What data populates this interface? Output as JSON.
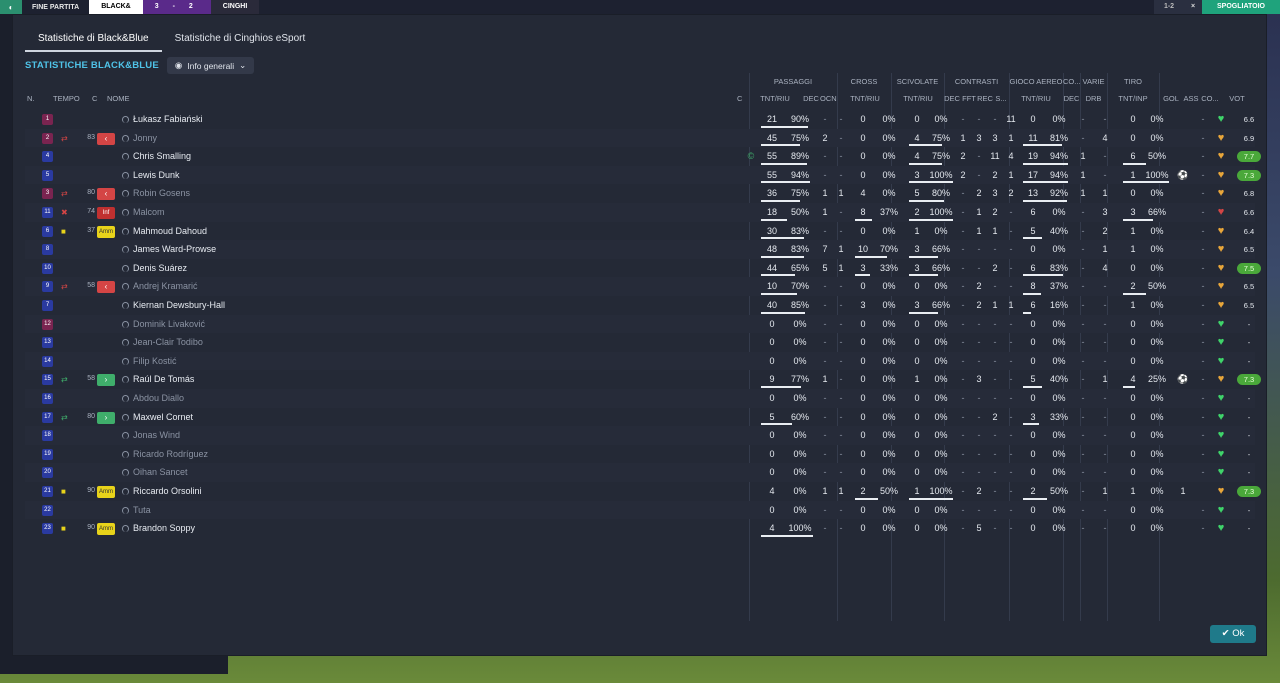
{
  "topbar": {
    "end_label": "FINE PARTITA",
    "team1": "BLACK&",
    "score": "3 - 2",
    "team2": "CINGHI",
    "s_label": "1-2",
    "close": "×",
    "skip": "SPOGLIATOIO"
  },
  "tabs": [
    "Statistiche di Black&Blue",
    "Statistiche di Cinghios eSport"
  ],
  "section_title": "STATISTICHE BLACK&BLUE",
  "dropdown": "Info generali",
  "groups": [
    "PASSAGGI",
    "CROSS",
    "SCIVOLATE",
    "CONTRASTI",
    "GIOCO AEREO",
    "CO...",
    "VARIE",
    "TIRO"
  ],
  "headers": {
    "n": "N.",
    "tempo": "TEMPO",
    "c": "C",
    "nome": "NOME",
    "c2": "C",
    "pass": "TNT/RIU",
    "dec": "DEC",
    "ocn": "OCN",
    "cross": "TNT/RIU",
    "sciv": "TNT/RIU",
    "cdec": "DEC",
    "cfft": "FFT",
    "crec": "REC",
    "cs": "S...",
    "aereo": "TNT/RIU",
    "codec": "DEC",
    "drb": "DRB",
    "tiro": "TNT/INP",
    "gol": "GOL",
    "ass": "ASS",
    "co": "CO...",
    "voto": "VOT"
  },
  "ok": "Ok",
  "players": [
    {
      "n": "1",
      "gk": true,
      "ev": "",
      "min": "",
      "sub": "",
      "name": "Łukasz Fabiański",
      "dim": false,
      "pt": "21",
      "pp": "90%",
      "dec": "-",
      "ocn": "-",
      "ct": "0",
      "cp": "0%",
      "st": "0",
      "sp": "0%",
      "cd": "-",
      "cf": "-",
      "cr": "-",
      "cs": "11",
      "at": "0",
      "ap": "0%",
      "cod": "-",
      "drb": "-",
      "tt": "0",
      "tp": "0%",
      "gol": "",
      "ass": "-",
      "vote": "6.6",
      "vg": false
    },
    {
      "n": "2",
      "gk": true,
      "ev": "⇄",
      "min": "83",
      "sub": "out",
      "name": "Jonny",
      "dim": true,
      "pt": "45",
      "pp": "75%",
      "dec": "2",
      "ocn": "-",
      "ct": "0",
      "cp": "0%",
      "st": "4",
      "sp": "75%",
      "cd": "1",
      "cf": "3",
      "cr": "3",
      "cs": "1",
      "at": "11",
      "ap": "81%",
      "cod": "-",
      "drb": "4",
      "tt": "0",
      "tp": "0%",
      "gol": "",
      "ass": "-",
      "vote": "6.9",
      "vg": false
    },
    {
      "n": "4",
      "gk": false,
      "ev": "",
      "min": "",
      "sub": "",
      "name": "Chris Smalling",
      "dim": false,
      "pt": "55",
      "pp": "89%",
      "dec": "-",
      "ocn": "-",
      "ct": "0",
      "cp": "0%",
      "st": "4",
      "sp": "75%",
      "cd": "2",
      "cf": "-",
      "cr": "11",
      "cs": "4",
      "at": "19",
      "ap": "94%",
      "cod": "1",
      "drb": "-",
      "tt": "6",
      "tp": "50%",
      "gol": "",
      "ass": "-",
      "vote": "7.7",
      "vg": true
    },
    {
      "n": "5",
      "gk": false,
      "ev": "",
      "min": "",
      "sub": "",
      "name": "Lewis Dunk",
      "dim": false,
      "pt": "55",
      "pp": "94%",
      "dec": "-",
      "ocn": "-",
      "ct": "0",
      "cp": "0%",
      "st": "3",
      "sp": "100%",
      "cd": "2",
      "cf": "-",
      "cr": "2",
      "cs": "1",
      "at": "17",
      "ap": "94%",
      "cod": "1",
      "drb": "-",
      "tt": "1",
      "tp": "100%",
      "gol": "⚽",
      "ass": "-",
      "vote": "7.3",
      "vg": true
    },
    {
      "n": "3",
      "gk": true,
      "ev": "⇄",
      "min": "80",
      "sub": "out",
      "name": "Robin Gosens",
      "dim": true,
      "pt": "36",
      "pp": "75%",
      "dec": "1",
      "ocn": "1",
      "ct": "4",
      "cp": "0%",
      "st": "5",
      "sp": "80%",
      "cd": "-",
      "cf": "2",
      "cr": "3",
      "cs": "2",
      "at": "13",
      "ap": "92%",
      "cod": "1",
      "drb": "1",
      "tt": "0",
      "tp": "0%",
      "gol": "",
      "ass": "-",
      "vote": "6.8",
      "vg": false
    },
    {
      "n": "11",
      "gk": false,
      "ev": "✖",
      "min": "74",
      "sub": "inf",
      "name": "Malcom",
      "dim": true,
      "pt": "18",
      "pp": "50%",
      "dec": "1",
      "ocn": "-",
      "ct": "8",
      "cp": "37%",
      "st": "2",
      "sp": "100%",
      "cd": "-",
      "cf": "1",
      "cr": "2",
      "cs": "-",
      "at": "6",
      "ap": "0%",
      "cod": "-",
      "drb": "3",
      "tt": "3",
      "tp": "66%",
      "gol": "",
      "ass": "-",
      "vote": "6.6",
      "vg": false
    },
    {
      "n": "6",
      "gk": false,
      "ev": "■",
      "min": "37",
      "sub": "amm",
      "name": "Mahmoud Dahoud",
      "dim": false,
      "pt": "30",
      "pp": "83%",
      "dec": "-",
      "ocn": "-",
      "ct": "0",
      "cp": "0%",
      "st": "1",
      "sp": "0%",
      "cd": "-",
      "cf": "1",
      "cr": "1",
      "cs": "-",
      "at": "5",
      "ap": "40%",
      "cod": "-",
      "drb": "2",
      "tt": "1",
      "tp": "0%",
      "gol": "",
      "ass": "-",
      "vote": "6.4",
      "vg": false
    },
    {
      "n": "8",
      "gk": false,
      "ev": "",
      "min": "",
      "sub": "",
      "name": "James Ward-Prowse",
      "dim": false,
      "pt": "48",
      "pp": "83%",
      "dec": "7",
      "ocn": "1",
      "ct": "10",
      "cp": "70%",
      "st": "3",
      "sp": "66%",
      "cd": "-",
      "cf": "-",
      "cr": "-",
      "cs": "-",
      "at": "0",
      "ap": "0%",
      "cod": "-",
      "drb": "1",
      "tt": "1",
      "tp": "0%",
      "gol": "",
      "ass": "-",
      "vote": "6.5",
      "vg": false
    },
    {
      "n": "10",
      "gk": false,
      "ev": "",
      "min": "",
      "sub": "",
      "name": "Denis Suárez",
      "dim": false,
      "pt": "44",
      "pp": "65%",
      "dec": "5",
      "ocn": "1",
      "ct": "3",
      "cp": "33%",
      "st": "3",
      "sp": "66%",
      "cd": "-",
      "cf": "-",
      "cr": "2",
      "cs": "-",
      "at": "6",
      "ap": "83%",
      "cod": "-",
      "drb": "4",
      "tt": "0",
      "tp": "0%",
      "gol": "",
      "ass": "-",
      "vote": "7.5",
      "vg": true
    },
    {
      "n": "9",
      "gk": false,
      "ev": "⇄",
      "min": "58",
      "sub": "out",
      "name": "Andrej Kramarić",
      "dim": true,
      "pt": "10",
      "pp": "70%",
      "dec": "-",
      "ocn": "-",
      "ct": "0",
      "cp": "0%",
      "st": "0",
      "sp": "0%",
      "cd": "-",
      "cf": "2",
      "cr": "-",
      "cs": "-",
      "at": "8",
      "ap": "37%",
      "cod": "-",
      "drb": "-",
      "tt": "2",
      "tp": "50%",
      "gol": "",
      "ass": "-",
      "vote": "6.5",
      "vg": false
    },
    {
      "n": "7",
      "gk": false,
      "ev": "",
      "min": "",
      "sub": "",
      "name": "Kiernan Dewsbury-Hall",
      "dim": false,
      "pt": "40",
      "pp": "85%",
      "dec": "-",
      "ocn": "-",
      "ct": "3",
      "cp": "0%",
      "st": "3",
      "sp": "66%",
      "cd": "-",
      "cf": "2",
      "cr": "1",
      "cs": "1",
      "at": "6",
      "ap": "16%",
      "cod": "-",
      "drb": "-",
      "tt": "1",
      "tp": "0%",
      "gol": "",
      "ass": "-",
      "vote": "6.5",
      "vg": false
    },
    {
      "n": "12",
      "gk": true,
      "ev": "",
      "min": "",
      "sub": "",
      "name": "Dominik Livaković",
      "dim": true,
      "pt": "0",
      "pp": "0%",
      "dec": "-",
      "ocn": "-",
      "ct": "0",
      "cp": "0%",
      "st": "0",
      "sp": "0%",
      "cd": "-",
      "cf": "-",
      "cr": "-",
      "cs": "-",
      "at": "0",
      "ap": "0%",
      "cod": "-",
      "drb": "-",
      "tt": "0",
      "tp": "0%",
      "gol": "",
      "ass": "-",
      "vote": "-",
      "vg": false
    },
    {
      "n": "13",
      "gk": false,
      "ev": "",
      "min": "",
      "sub": "",
      "name": "Jean-Clair Todibo",
      "dim": true,
      "pt": "0",
      "pp": "0%",
      "dec": "-",
      "ocn": "-",
      "ct": "0",
      "cp": "0%",
      "st": "0",
      "sp": "0%",
      "cd": "-",
      "cf": "-",
      "cr": "-",
      "cs": "-",
      "at": "0",
      "ap": "0%",
      "cod": "-",
      "drb": "-",
      "tt": "0",
      "tp": "0%",
      "gol": "",
      "ass": "-",
      "vote": "-",
      "vg": false
    },
    {
      "n": "14",
      "gk": false,
      "ev": "",
      "min": "",
      "sub": "",
      "name": "Filip Kostić",
      "dim": true,
      "pt": "0",
      "pp": "0%",
      "dec": "-",
      "ocn": "-",
      "ct": "0",
      "cp": "0%",
      "st": "0",
      "sp": "0%",
      "cd": "-",
      "cf": "-",
      "cr": "-",
      "cs": "-",
      "at": "0",
      "ap": "0%",
      "cod": "-",
      "drb": "-",
      "tt": "0",
      "tp": "0%",
      "gol": "",
      "ass": "-",
      "vote": "-",
      "vg": false
    },
    {
      "n": "15",
      "gk": false,
      "ev": "⇄",
      "min": "58",
      "sub": "in",
      "name": "Raúl De Tomás",
      "dim": false,
      "pt": "9",
      "pp": "77%",
      "dec": "1",
      "ocn": "-",
      "ct": "0",
      "cp": "0%",
      "st": "1",
      "sp": "0%",
      "cd": "-",
      "cf": "3",
      "cr": "-",
      "cs": "-",
      "at": "5",
      "ap": "40%",
      "cod": "-",
      "drb": "1",
      "tt": "4",
      "tp": "25%",
      "gol": "⚽",
      "ass": "-",
      "vote": "7.3",
      "vg": true
    },
    {
      "n": "16",
      "gk": false,
      "ev": "",
      "min": "",
      "sub": "",
      "name": "Abdou Diallo",
      "dim": true,
      "pt": "0",
      "pp": "0%",
      "dec": "-",
      "ocn": "-",
      "ct": "0",
      "cp": "0%",
      "st": "0",
      "sp": "0%",
      "cd": "-",
      "cf": "-",
      "cr": "-",
      "cs": "-",
      "at": "0",
      "ap": "0%",
      "cod": "-",
      "drb": "-",
      "tt": "0",
      "tp": "0%",
      "gol": "",
      "ass": "-",
      "vote": "-",
      "vg": false
    },
    {
      "n": "17",
      "gk": false,
      "ev": "⇄",
      "min": "80",
      "sub": "in",
      "name": "Maxwel Cornet",
      "dim": false,
      "pt": "5",
      "pp": "60%",
      "dec": "-",
      "ocn": "-",
      "ct": "0",
      "cp": "0%",
      "st": "0",
      "sp": "0%",
      "cd": "-",
      "cf": "-",
      "cr": "2",
      "cs": "-",
      "at": "3",
      "ap": "33%",
      "cod": "-",
      "drb": "-",
      "tt": "0",
      "tp": "0%",
      "gol": "",
      "ass": "-",
      "vote": "-",
      "vg": false
    },
    {
      "n": "18",
      "gk": false,
      "ev": "",
      "min": "",
      "sub": "",
      "name": "Jonas Wind",
      "dim": true,
      "pt": "0",
      "pp": "0%",
      "dec": "-",
      "ocn": "-",
      "ct": "0",
      "cp": "0%",
      "st": "0",
      "sp": "0%",
      "cd": "-",
      "cf": "-",
      "cr": "-",
      "cs": "-",
      "at": "0",
      "ap": "0%",
      "cod": "-",
      "drb": "-",
      "tt": "0",
      "tp": "0%",
      "gol": "",
      "ass": "-",
      "vote": "-",
      "vg": false
    },
    {
      "n": "19",
      "gk": false,
      "ev": "",
      "min": "",
      "sub": "",
      "name": "Ricardo Rodríguez",
      "dim": true,
      "pt": "0",
      "pp": "0%",
      "dec": "-",
      "ocn": "-",
      "ct": "0",
      "cp": "0%",
      "st": "0",
      "sp": "0%",
      "cd": "-",
      "cf": "-",
      "cr": "-",
      "cs": "-",
      "at": "0",
      "ap": "0%",
      "cod": "-",
      "drb": "-",
      "tt": "0",
      "tp": "0%",
      "gol": "",
      "ass": "-",
      "vote": "-",
      "vg": false
    },
    {
      "n": "20",
      "gk": false,
      "ev": "",
      "min": "",
      "sub": "",
      "name": "Oihan Sancet",
      "dim": true,
      "pt": "0",
      "pp": "0%",
      "dec": "-",
      "ocn": "-",
      "ct": "0",
      "cp": "0%",
      "st": "0",
      "sp": "0%",
      "cd": "-",
      "cf": "-",
      "cr": "-",
      "cs": "-",
      "at": "0",
      "ap": "0%",
      "cod": "-",
      "drb": "-",
      "tt": "0",
      "tp": "0%",
      "gol": "",
      "ass": "-",
      "vote": "-",
      "vg": false
    },
    {
      "n": "21",
      "gk": false,
      "ev": "■",
      "min": "90",
      "sub": "amm",
      "name": "Riccardo Orsolini",
      "dim": false,
      "pt": "4",
      "pp": "0%",
      "dec": "1",
      "ocn": "1",
      "ct": "2",
      "cp": "50%",
      "st": "1",
      "sp": "100%",
      "cd": "-",
      "cf": "2",
      "cr": "-",
      "cs": "-",
      "at": "2",
      "ap": "50%",
      "cod": "-",
      "drb": "1",
      "tt": "1",
      "tp": "0%",
      "gol": "1",
      "ass": "",
      "vote": "7.3",
      "vg": true
    },
    {
      "n": "22",
      "gk": false,
      "ev": "",
      "min": "",
      "sub": "",
      "name": "Tuta",
      "dim": true,
      "pt": "0",
      "pp": "0%",
      "dec": "-",
      "ocn": "-",
      "ct": "0",
      "cp": "0%",
      "st": "0",
      "sp": "0%",
      "cd": "-",
      "cf": "-",
      "cr": "-",
      "cs": "-",
      "at": "0",
      "ap": "0%",
      "cod": "-",
      "drb": "-",
      "tt": "0",
      "tp": "0%",
      "gol": "",
      "ass": "-",
      "vote": "-",
      "vg": false
    },
    {
      "n": "23",
      "gk": false,
      "ev": "■",
      "min": "90",
      "sub": "amm",
      "name": "Brandon Soppy",
      "dim": false,
      "pt": "4",
      "pp": "100%",
      "dec": "-",
      "ocn": "-",
      "ct": "0",
      "cp": "0%",
      "st": "0",
      "sp": "0%",
      "cd": "-",
      "cf": "5",
      "cr": "-",
      "cs": "-",
      "at": "0",
      "ap": "0%",
      "cod": "-",
      "drb": "-",
      "tt": "0",
      "tp": "0%",
      "gol": "",
      "ass": "-",
      "vote": "-",
      "vg": false
    }
  ]
}
